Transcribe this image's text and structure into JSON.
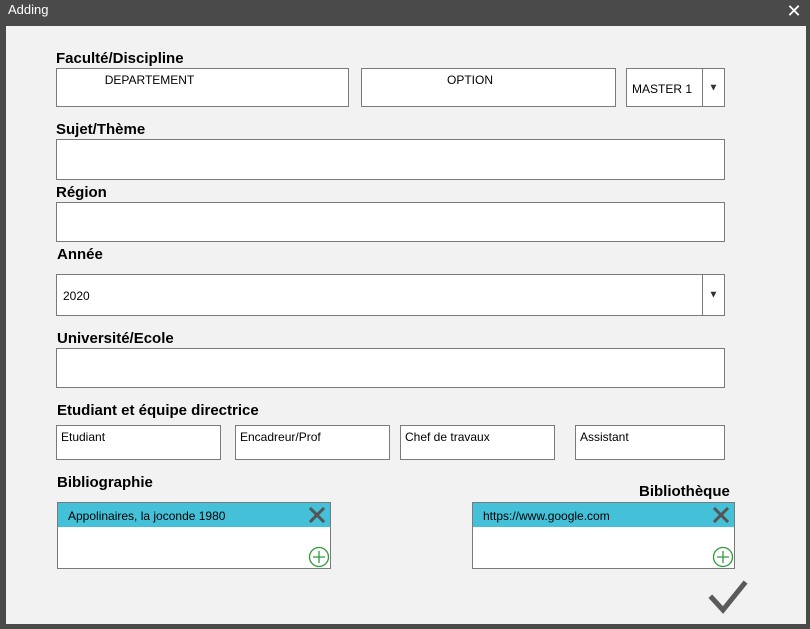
{
  "window": {
    "title": "Adding",
    "close_icon": "close-icon"
  },
  "form": {
    "faculte": {
      "label": "Faculté/Discipline",
      "departement_value": "DEPARTEMENT",
      "option_value": "OPTION",
      "level_selected": "MASTER 1"
    },
    "sujet": {
      "label": "Sujet/Thème",
      "value": ""
    },
    "region": {
      "label": "Région",
      "value": ""
    },
    "annee": {
      "label": "Année",
      "selected": "2020"
    },
    "universite": {
      "label": "Université/Ecole",
      "value": ""
    },
    "equipe": {
      "label": "Etudiant et équipe directrice",
      "etudiant": "Etudiant",
      "encadreur": "Encadreur/Prof",
      "chef": "Chef de travaux",
      "assistant": "Assistant"
    },
    "bibliographie": {
      "label": "Bibliographie",
      "items": [
        "Appolinaires, la joconde 1980"
      ]
    },
    "bibliotheque": {
      "label": "Bibliothèque",
      "items": [
        "https://www.google.com"
      ]
    }
  },
  "colors": {
    "selected_item": "#44c1d9",
    "add_icon": "#2e9b3a",
    "remove_icon": "#555555",
    "confirm_icon": "#5a5a5a"
  }
}
